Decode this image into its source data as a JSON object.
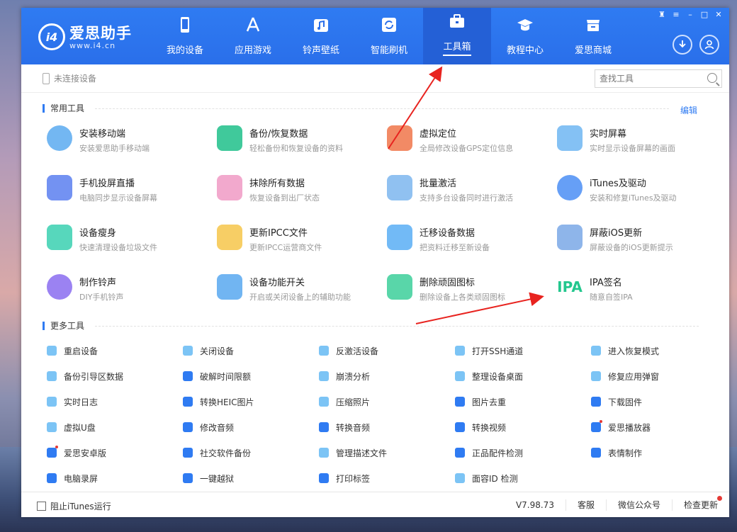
{
  "app": {
    "name": "爱思助手",
    "url": "www.i4.cn",
    "logo_mark": "i4"
  },
  "nav": [
    {
      "id": "my-device",
      "label": "我的设备",
      "icon": "phone-icon"
    },
    {
      "id": "apps-games",
      "label": "应用游戏",
      "icon": "app-store-icon"
    },
    {
      "id": "ringtones",
      "label": "铃声壁纸",
      "icon": "music-icon"
    },
    {
      "id": "flash",
      "label": "智能刷机",
      "icon": "refresh-icon"
    },
    {
      "id": "toolbox",
      "label": "工具箱",
      "icon": "toolbox-icon",
      "active": true
    },
    {
      "id": "tutorials",
      "label": "教程中心",
      "icon": "graduation-cap-icon"
    },
    {
      "id": "mall",
      "label": "爱思商城",
      "icon": "store-icon"
    }
  ],
  "device_bar": {
    "status": "未连接设备",
    "search_placeholder": "查找工具"
  },
  "common_tools": {
    "heading": "常用工具",
    "edit_label": "编辑",
    "items": [
      {
        "title": "安装移动端",
        "desc": "安装爱思助手移动端",
        "icon": "i4-logo-icon",
        "color": "#5aaaf0"
      },
      {
        "title": "备份/恢复数据",
        "desc": "轻松备份和恢复设备的资料",
        "icon": "layers-icon",
        "color": "#1ec08a"
      },
      {
        "title": "虚拟定位",
        "desc": "全局修改设备GPS定位信息",
        "icon": "map-pin-icon",
        "color": "#f0764a"
      },
      {
        "title": "实时屏幕",
        "desc": "实时显示设备屏幕的画面",
        "icon": "screen-icon",
        "color": "#6fb6f2"
      },
      {
        "title": "手机投屏直播",
        "desc": "电脑同步显示设备屏幕",
        "icon": "cast-icon",
        "color": "#5b7ff0"
      },
      {
        "title": "抹除所有数据",
        "desc": "恢复设备到出厂状态",
        "icon": "eraser-icon",
        "color": "#f09ac4"
      },
      {
        "title": "批量激活",
        "desc": "支持多台设备同时进行激活",
        "icon": "stack-icon",
        "color": "#7cb6ef"
      },
      {
        "title": "iTunes及驱动",
        "desc": "安装和修复iTunes及驱动",
        "icon": "itunes-icon",
        "color": "#4b8ef5"
      },
      {
        "title": "设备瘦身",
        "desc": "快速清理设备垃圾文件",
        "icon": "broom-icon",
        "color": "#39d0b0"
      },
      {
        "title": "更新IPCC文件",
        "desc": "更新IPCC运营商文件",
        "icon": "folder-icon",
        "color": "#f6c54a"
      },
      {
        "title": "迁移设备数据",
        "desc": "把资料迁移至新设备",
        "icon": "migrate-icon",
        "color": "#59aef5"
      },
      {
        "title": "屏蔽iOS更新",
        "desc": "屏蔽设备的iOS更新提示",
        "icon": "block-update-icon",
        "color": "#7aa8e6"
      },
      {
        "title": "制作铃声",
        "desc": "DIY手机铃声",
        "icon": "ringtone-icon",
        "color": "#8a6cf0"
      },
      {
        "title": "设备功能开关",
        "desc": "开启或关闭设备上的辅助功能",
        "icon": "sliders-icon",
        "color": "#58a8f0"
      },
      {
        "title": "删除顽固图标",
        "desc": "删除设备上各类顽固图标",
        "icon": "trash-icon",
        "color": "#3ccf9a"
      },
      {
        "title": "IPA签名",
        "desc": "随意自签IPA",
        "icon": "ipa-icon",
        "color": "#23c78e",
        "icon_text": "IPA"
      }
    ]
  },
  "more_tools": {
    "heading": "更多工具",
    "items": [
      {
        "label": "重启设备",
        "icon": "restart-icon",
        "color": "#7cc4f5"
      },
      {
        "label": "关闭设备",
        "icon": "power-icon",
        "color": "#7cc4f5"
      },
      {
        "label": "反激活设备",
        "icon": "deactivate-icon",
        "color": "#7cc4f5"
      },
      {
        "label": "打开SSH通道",
        "icon": "ssh-icon",
        "color": "#7cc4f5"
      },
      {
        "label": "进入恢复模式",
        "icon": "recovery-icon",
        "color": "#7cc4f5"
      },
      {
        "label": "备份引导区数据",
        "icon": "backup-boot-icon",
        "color": "#7cc4f5"
      },
      {
        "label": "破解时间限额",
        "icon": "clock-icon",
        "color": "#2f7bf2"
      },
      {
        "label": "崩溃分析",
        "icon": "crash-icon",
        "color": "#7cc4f5"
      },
      {
        "label": "整理设备桌面",
        "icon": "grid-icon",
        "color": "#7cc4f5"
      },
      {
        "label": "修复应用弹窗",
        "icon": "popup-fix-icon",
        "color": "#7cc4f5"
      },
      {
        "label": "实时日志",
        "icon": "log-icon",
        "color": "#7cc4f5"
      },
      {
        "label": "转换HEIC图片",
        "icon": "heic-icon",
        "color": "#2f7bf2"
      },
      {
        "label": "压缩照片",
        "icon": "compress-icon",
        "color": "#7cc4f5"
      },
      {
        "label": "图片去重",
        "icon": "dedupe-icon",
        "color": "#2f7bf2"
      },
      {
        "label": "下载固件",
        "icon": "firmware-icon",
        "color": "#2f7bf2"
      },
      {
        "label": "虚拟U盘",
        "icon": "usb-icon",
        "color": "#7cc4f5"
      },
      {
        "label": "修改音频",
        "icon": "audio-icon",
        "color": "#2f7bf2"
      },
      {
        "label": "转换音频",
        "icon": "convert-audio-icon",
        "color": "#2f7bf2"
      },
      {
        "label": "转换视频",
        "icon": "video-icon",
        "color": "#2f7bf2"
      },
      {
        "label": "爱思播放器",
        "icon": "player-icon",
        "color": "#2f7bf2",
        "dot": true
      },
      {
        "label": "爱思安卓版",
        "icon": "android-icon",
        "color": "#2f7bf2",
        "dot": true
      },
      {
        "label": "社交软件备份",
        "icon": "social-backup-icon",
        "color": "#2f7bf2"
      },
      {
        "label": "管理描述文件",
        "icon": "profile-icon",
        "color": "#7cc4f5"
      },
      {
        "label": "正品配件检测",
        "icon": "accessory-icon",
        "color": "#2f7bf2"
      },
      {
        "label": "表情制作",
        "icon": "emoji-icon",
        "color": "#2f7bf2"
      },
      {
        "label": "电脑录屏",
        "icon": "record-icon",
        "color": "#2f7bf2"
      },
      {
        "label": "一键越狱",
        "icon": "unlock-icon",
        "color": "#2f7bf2"
      },
      {
        "label": "打印标签",
        "icon": "print-icon",
        "color": "#2f7bf2"
      },
      {
        "label": "面容ID 检测",
        "icon": "faceid-icon",
        "color": "#7cc4f5"
      }
    ]
  },
  "footer": {
    "itunes_block": "阻止iTunes运行",
    "version": "V7.98.73",
    "service": "客服",
    "wechat": "微信公众号",
    "update": "检查更新"
  }
}
